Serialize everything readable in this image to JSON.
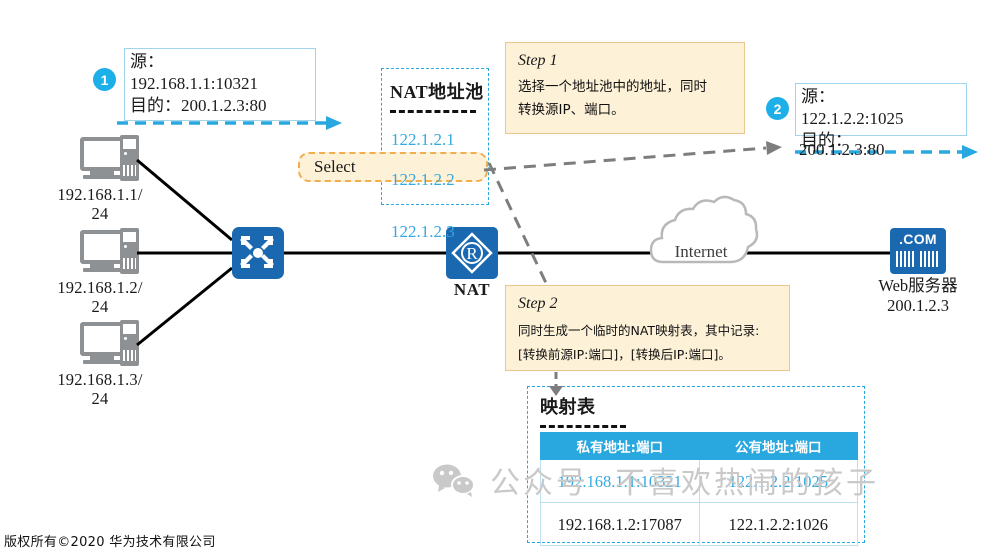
{
  "title_footer": "版权所有©2020 华为技术有限公司",
  "hosts": [
    {
      "label_line1": "192.168.1.1/",
      "label_line2": "24",
      "icon": "pc-icon"
    },
    {
      "label_line1": "192.168.1.2/",
      "label_line2": "24",
      "icon": "pc-icon"
    },
    {
      "label_line1": "192.168.1.3/",
      "label_line2": "24",
      "icon": "pc-icon"
    }
  ],
  "devices": {
    "switch_icon": "switch-icon",
    "router_icon": "router-icon",
    "router_label": "NAT",
    "cloud_label": "Internet",
    "server_badge": ".COM",
    "server_label_line1": "Web服务器",
    "server_label_line2": "200.1.2.3"
  },
  "packet_left": {
    "badge": "1",
    "line1": "源：",
    "line2": "192.168.1.1:10321",
    "line3": "目的：200.1.2.3:80"
  },
  "packet_right": {
    "badge": "2",
    "line1": "源：",
    "line2": "122.1.2.2:1025",
    "line3": "目的：",
    "line4": "200.1.2.3:80"
  },
  "pool": {
    "title": "NAT地址池",
    "entries": [
      "122.1.2.1",
      "122.1.2.2",
      "122.1.2.3"
    ]
  },
  "select_pill": {
    "label": "Select"
  },
  "steps": [
    {
      "head": "Step 1",
      "line1": "选择一个地址池中的地址，同时",
      "line2": "转换源IP、端口。"
    },
    {
      "head": "Step 2",
      "line1": "同时生成一个临时的NAT映射表，其中记录:",
      "line2": "[转换前源IP:端口]，[转换后IP:端口]。"
    }
  ],
  "mapping_table": {
    "title": "映射表",
    "columns": [
      "私有地址:端口",
      "公有地址:端口"
    ],
    "rows": [
      {
        "private": "192.168.1.1:10321",
        "public": "122.1.2.2:1025",
        "highlight": true
      },
      {
        "private": "192.168.1.2:17087",
        "public": "122.1.2.2:1026",
        "highlight": false
      }
    ]
  },
  "watermark": {
    "text1": "公众号",
    "text2": "不喜欢热闹的孩子",
    "logo": "wechat-icon"
  },
  "colors": {
    "device_blue": "#1a68b0",
    "accent_cyan": "#29a8e0",
    "badge_blue": "#1cafe8",
    "callout_bg": "#fdf1d8",
    "callout_border": "#e8c88c",
    "pool_text": "#36a9e1"
  }
}
